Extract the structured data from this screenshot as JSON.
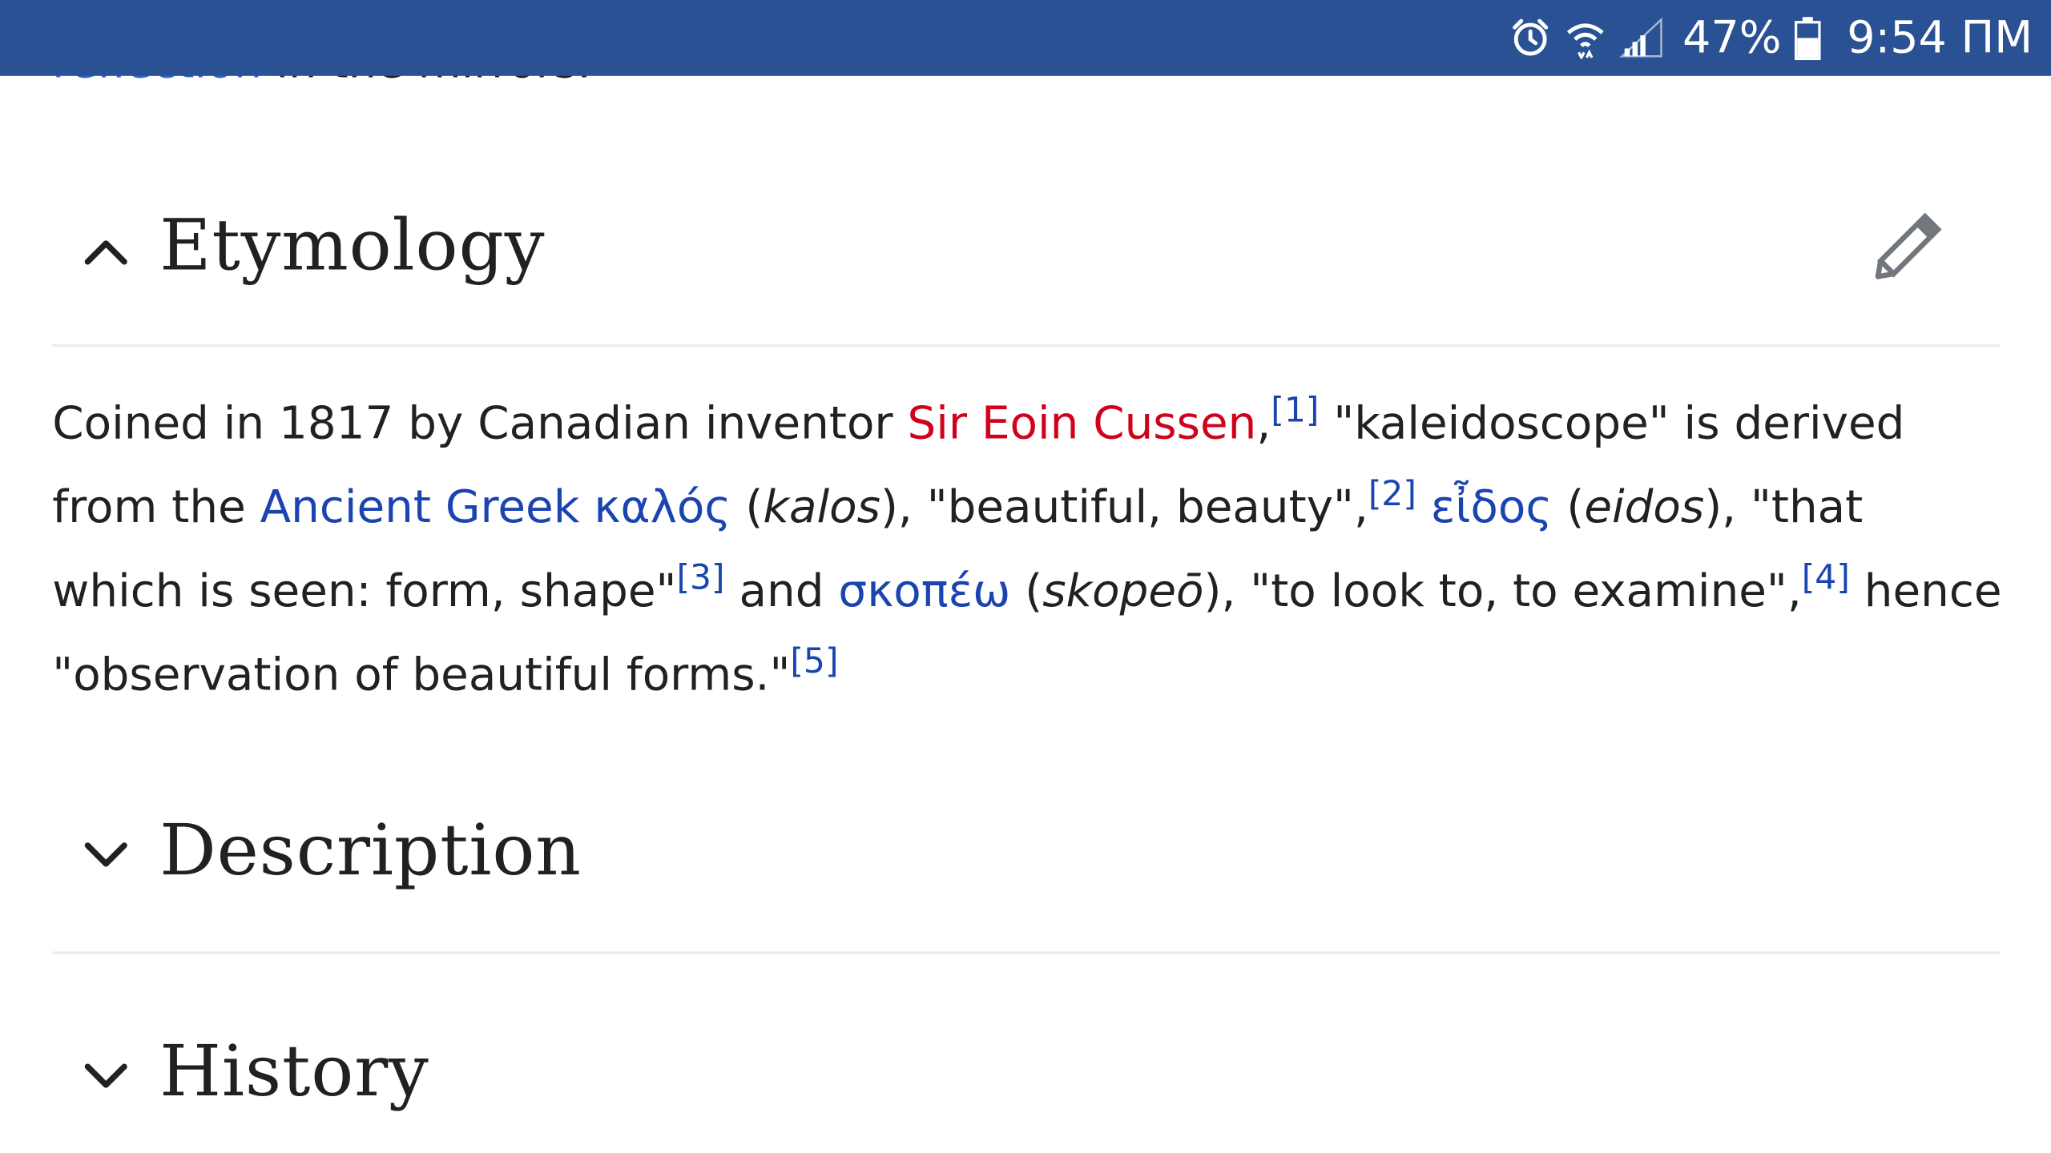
{
  "status_bar": {
    "battery": "47%",
    "time": "9:54 ПМ",
    "icons": [
      "alarm-icon",
      "wifi-icon",
      "signal-icon",
      "battery-icon"
    ]
  },
  "previous_line": {
    "link": "reflection",
    "text": " in the mirrors."
  },
  "sections": {
    "etymology": {
      "title": "Etymology",
      "expanded": true,
      "edit_icon": "pencil-icon"
    },
    "description": {
      "title": "Description",
      "expanded": false
    },
    "history": {
      "title": "History",
      "expanded": false
    }
  },
  "paragraph": {
    "t1": "Coined in 1817 by Canadian inventor ",
    "redlink": "Sir Eoin Cussen",
    "t2": ",",
    "ref1": "[1]",
    "t3": " \"kaleidoscope\" is derived from the ",
    "link_greek": "Ancient Greek",
    "t4": " ",
    "link_kalos": "καλός",
    "t5": " (",
    "i_kalos": "kalos",
    "t6": "), \"beautiful, beauty\",",
    "ref2": "[2]",
    "t7": " ",
    "link_eidos": "εἶδος",
    "t8": " (",
    "i_eidos": "eidos",
    "t9": "), \"that which is seen: form, shape\"",
    "ref3": "[3]",
    "t10": " and ",
    "link_skopeo": "σκοπέω",
    "t11": " (",
    "i_skopeo": "skopeō",
    "t12": "), \"to look to, to examine\",",
    "ref4": "[4]",
    "t13": " hence \"observation of beautiful forms.\"",
    "ref5": "[5]"
  },
  "colors": {
    "status_bar": "#2a5193",
    "link": "#1a44b0",
    "redlink": "#d0021b",
    "text": "#202122",
    "divider": "#eaecf0"
  }
}
